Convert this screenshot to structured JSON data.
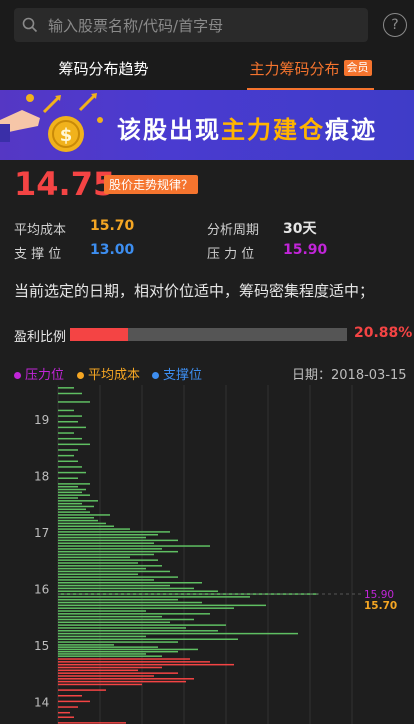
{
  "search": {
    "placeholder": "输入股票名称/代码/首字母",
    "help_label": "?"
  },
  "tabs": [
    {
      "label": "筹码分布趋势"
    },
    {
      "label": "主力筹码分布",
      "badge": "会员"
    }
  ],
  "banner": {
    "text_pre": "该股出现",
    "text_highlight": "主力建仓",
    "text_post": "痕迹"
  },
  "price": {
    "value": "14.75",
    "trend_tag": "股价走势规律？"
  },
  "stats": {
    "avg_cost_label": "平均成本",
    "avg_cost_value": "15.70",
    "period_label": "分析周期",
    "period_value": "30天",
    "support_label": "支 撑 位",
    "support_value": "13.00",
    "pressure_label": "压 力 位",
    "pressure_value": "15.90"
  },
  "description": "当前选定的日期，相对价位适中，筹码密集程度适中；",
  "profit": {
    "label": "盈利比例",
    "value": "20.88%",
    "fraction": 0.2088
  },
  "legend": [
    {
      "label": "压力位",
      "color": "#c125d8"
    },
    {
      "label": "平均成本",
      "color": "#f5a623"
    },
    {
      "label": "支撑位",
      "color": "#3d8ef0"
    }
  ],
  "date": {
    "label": "日期：",
    "value": "2018-03-15"
  },
  "colors": {
    "up": "#f44444",
    "down": "#5fbf62",
    "accent": "#f5742e"
  },
  "chart_data": {
    "type": "bar",
    "orientation": "horizontal",
    "y_ticks": [
      14,
      15,
      16,
      17,
      18,
      19
    ],
    "y_range": [
      13.6,
      19.6
    ],
    "current_price": 14.75,
    "pressure": 15.9,
    "avg_cost": 15.7,
    "bars": [
      {
        "p": 13.62,
        "v": 17
      },
      {
        "p": 13.72,
        "v": 4
      },
      {
        "p": 13.8,
        "v": 3
      },
      {
        "p": 13.9,
        "v": 5
      },
      {
        "p": 14.0,
        "v": 8
      },
      {
        "p": 14.1,
        "v": 6
      },
      {
        "p": 14.2,
        "v": 12
      },
      {
        "p": 14.3,
        "v": 21
      },
      {
        "p": 14.35,
        "v": 32
      },
      {
        "p": 14.4,
        "v": 34
      },
      {
        "p": 14.45,
        "v": 24
      },
      {
        "p": 14.5,
        "v": 30
      },
      {
        "p": 14.55,
        "v": 20
      },
      {
        "p": 14.6,
        "v": 26
      },
      {
        "p": 14.65,
        "v": 44
      },
      {
        "p": 14.7,
        "v": 38
      },
      {
        "p": 14.75,
        "v": 33
      },
      {
        "p": 14.8,
        "v": 26
      },
      {
        "p": 14.84,
        "v": 22
      },
      {
        "p": 14.88,
        "v": 30
      },
      {
        "p": 14.92,
        "v": 35
      },
      {
        "p": 14.96,
        "v": 25
      },
      {
        "p": 15.0,
        "v": 14
      },
      {
        "p": 15.05,
        "v": 30
      },
      {
        "p": 15.1,
        "v": 45
      },
      {
        "p": 15.15,
        "v": 22
      },
      {
        "p": 15.2,
        "v": 60
      },
      {
        "p": 15.25,
        "v": 40
      },
      {
        "p": 15.3,
        "v": 32
      },
      {
        "p": 15.35,
        "v": 42
      },
      {
        "p": 15.4,
        "v": 28
      },
      {
        "p": 15.45,
        "v": 34
      },
      {
        "p": 15.5,
        "v": 26
      },
      {
        "p": 15.55,
        "v": 38
      },
      {
        "p": 15.6,
        "v": 22
      },
      {
        "p": 15.65,
        "v": 44
      },
      {
        "p": 15.7,
        "v": 52
      },
      {
        "p": 15.75,
        "v": 36
      },
      {
        "p": 15.8,
        "v": 30
      },
      {
        "p": 15.85,
        "v": 48
      },
      {
        "p": 15.9,
        "v": 65
      },
      {
        "p": 15.95,
        "v": 40
      },
      {
        "p": 16.0,
        "v": 34
      },
      {
        "p": 16.05,
        "v": 28
      },
      {
        "p": 16.1,
        "v": 36
      },
      {
        "p": 16.15,
        "v": 24
      },
      {
        "p": 16.2,
        "v": 30
      },
      {
        "p": 16.25,
        "v": 20
      },
      {
        "p": 16.3,
        "v": 28
      },
      {
        "p": 16.35,
        "v": 22
      },
      {
        "p": 16.4,
        "v": 26
      },
      {
        "p": 16.45,
        "v": 20
      },
      {
        "p": 16.5,
        "v": 25
      },
      {
        "p": 16.55,
        "v": 18
      },
      {
        "p": 16.6,
        "v": 24
      },
      {
        "p": 16.65,
        "v": 30
      },
      {
        "p": 16.7,
        "v": 26
      },
      {
        "p": 16.75,
        "v": 38
      },
      {
        "p": 16.8,
        "v": 24
      },
      {
        "p": 16.85,
        "v": 30
      },
      {
        "p": 16.9,
        "v": 22
      },
      {
        "p": 16.95,
        "v": 25
      },
      {
        "p": 17.0,
        "v": 28
      },
      {
        "p": 17.05,
        "v": 18
      },
      {
        "p": 17.1,
        "v": 14
      },
      {
        "p": 17.15,
        "v": 12
      },
      {
        "p": 17.2,
        "v": 10
      },
      {
        "p": 17.25,
        "v": 9
      },
      {
        "p": 17.3,
        "v": 13
      },
      {
        "p": 17.35,
        "v": 8
      },
      {
        "p": 17.4,
        "v": 7
      },
      {
        "p": 17.45,
        "v": 9
      },
      {
        "p": 17.5,
        "v": 6
      },
      {
        "p": 17.55,
        "v": 10
      },
      {
        "p": 17.6,
        "v": 5
      },
      {
        "p": 17.65,
        "v": 8
      },
      {
        "p": 17.7,
        "v": 6
      },
      {
        "p": 17.75,
        "v": 7
      },
      {
        "p": 17.8,
        "v": 5
      },
      {
        "p": 17.85,
        "v": 8
      },
      {
        "p": 17.95,
        "v": 5
      },
      {
        "p": 18.05,
        "v": 7
      },
      {
        "p": 18.15,
        "v": 6
      },
      {
        "p": 18.25,
        "v": 5
      },
      {
        "p": 18.35,
        "v": 4
      },
      {
        "p": 18.45,
        "v": 5
      },
      {
        "p": 18.55,
        "v": 8
      },
      {
        "p": 18.65,
        "v": 6
      },
      {
        "p": 18.75,
        "v": 4
      },
      {
        "p": 18.85,
        "v": 7
      },
      {
        "p": 18.95,
        "v": 5
      },
      {
        "p": 19.05,
        "v": 6
      },
      {
        "p": 19.15,
        "v": 4
      },
      {
        "p": 19.3,
        "v": 8
      },
      {
        "p": 19.45,
        "v": 6
      },
      {
        "p": 19.55,
        "v": 4
      }
    ]
  }
}
